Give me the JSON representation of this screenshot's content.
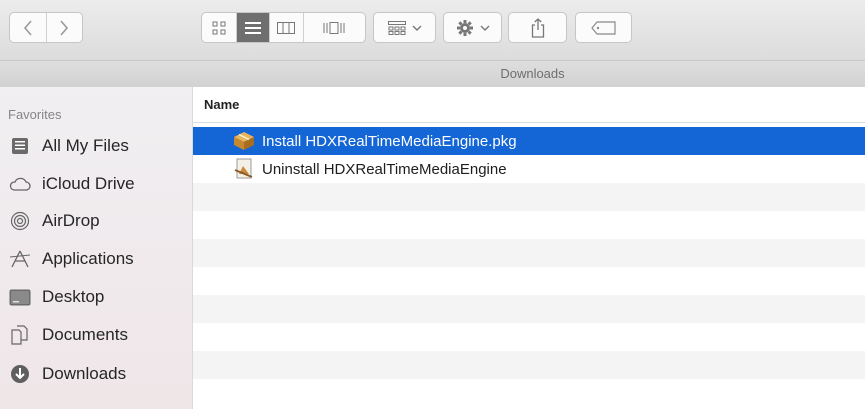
{
  "window": {
    "title": "Downloads"
  },
  "toolbar": {
    "nav": [
      "back",
      "forward"
    ],
    "view_modes": [
      "icon-view",
      "list-view",
      "column-view",
      "cover-flow-view"
    ],
    "arrange_label": "arrange",
    "action_label": "action",
    "share_label": "share",
    "tags_label": "tags"
  },
  "sidebar": {
    "header": "Favorites",
    "items": [
      {
        "label": "All My Files",
        "icon": "all-my-files-icon"
      },
      {
        "label": "iCloud Drive",
        "icon": "cloud-icon"
      },
      {
        "label": "AirDrop",
        "icon": "airdrop-icon"
      },
      {
        "label": "Applications",
        "icon": "applications-icon"
      },
      {
        "label": "Desktop",
        "icon": "desktop-icon"
      },
      {
        "label": "Documents",
        "icon": "documents-icon"
      },
      {
        "label": "Downloads",
        "icon": "downloads-icon"
      }
    ]
  },
  "list": {
    "column_name": "Name",
    "files": [
      {
        "name": "Install HDXRealTimeMediaEngine.pkg",
        "icon": "package-icon",
        "selected": true
      },
      {
        "name": "Uninstall HDXRealTimeMediaEngine",
        "icon": "uninstaller-icon",
        "selected": false
      }
    ]
  },
  "colors": {
    "selection": "#1465d6",
    "text": "#1e1e1e"
  }
}
